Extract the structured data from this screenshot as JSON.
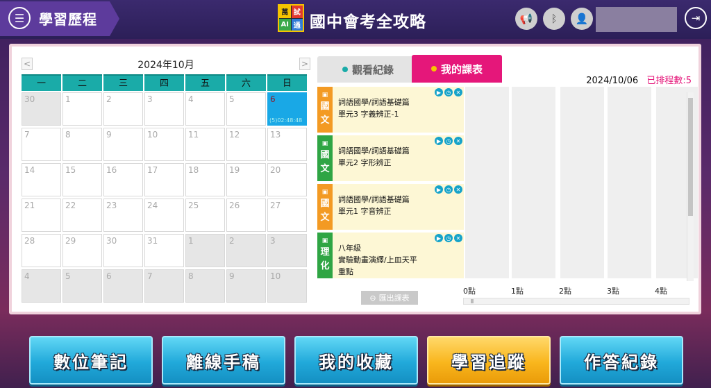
{
  "header": {
    "breadcrumb": "學習歷程",
    "logo_chars": [
      "萬",
      "試",
      "AI",
      "通"
    ],
    "app_title": "國中會考全攻略"
  },
  "calendar": {
    "month_label": "2024年10月",
    "prev": "<",
    "next": ">",
    "weekdays": [
      "一",
      "二",
      "三",
      "四",
      "五",
      "六",
      "日"
    ],
    "days": [
      {
        "d": "30",
        "m": true
      },
      {
        "d": "1"
      },
      {
        "d": "2"
      },
      {
        "d": "3"
      },
      {
        "d": "4"
      },
      {
        "d": "5"
      },
      {
        "d": "6",
        "today": true,
        "sub": "(5)02:48:48"
      },
      {
        "d": "7"
      },
      {
        "d": "8"
      },
      {
        "d": "9"
      },
      {
        "d": "10"
      },
      {
        "d": "11"
      },
      {
        "d": "12"
      },
      {
        "d": "13"
      },
      {
        "d": "14"
      },
      {
        "d": "15"
      },
      {
        "d": "16"
      },
      {
        "d": "17"
      },
      {
        "d": "18"
      },
      {
        "d": "19"
      },
      {
        "d": "20"
      },
      {
        "d": "21"
      },
      {
        "d": "22"
      },
      {
        "d": "23"
      },
      {
        "d": "24"
      },
      {
        "d": "25"
      },
      {
        "d": "26"
      },
      {
        "d": "27"
      },
      {
        "d": "28"
      },
      {
        "d": "29"
      },
      {
        "d": "30"
      },
      {
        "d": "31"
      },
      {
        "d": "1",
        "m": true
      },
      {
        "d": "2",
        "m": true
      },
      {
        "d": "3",
        "m": true
      },
      {
        "d": "4",
        "m": true
      },
      {
        "d": "5",
        "m": true
      },
      {
        "d": "6",
        "m": true
      },
      {
        "d": "7",
        "m": true
      },
      {
        "d": "8",
        "m": true
      },
      {
        "d": "9",
        "m": true
      },
      {
        "d": "10",
        "m": true
      }
    ]
  },
  "tabs": {
    "watch": "觀看紀錄",
    "schedule": "我的課表"
  },
  "schedule": {
    "date": "2024/10/06",
    "count_label": "已排程數:5",
    "lessons": [
      {
        "subject_line1": "國",
        "subject_line2": "文",
        "color": "orange",
        "line1": "詞語國學/詞語基礎篇",
        "line2": "單元3 字義辨正-1",
        "line3": ""
      },
      {
        "subject_line1": "國",
        "subject_line2": "文",
        "color": "green",
        "line1": "詞語國學/詞語基礎篇",
        "line2": "單元2 字形辨正",
        "line3": ""
      },
      {
        "subject_line1": "國",
        "subject_line2": "文",
        "color": "orange",
        "line1": "詞語國學/詞語基礎篇",
        "line2": "單元1 字音辨正",
        "line3": ""
      },
      {
        "subject_line1": "理",
        "subject_line2": "化",
        "color": "green",
        "line1": "八年級",
        "line2": "實驗動畫演繹/上皿天平",
        "line3": "重點"
      }
    ],
    "export_label": "匯出課表",
    "hours": [
      "0點",
      "1點",
      "2點",
      "3點",
      "4點"
    ]
  },
  "bottom_nav": [
    {
      "label": "數位筆記",
      "active": false
    },
    {
      "label": "離線手稿",
      "active": false
    },
    {
      "label": "我的收藏",
      "active": false
    },
    {
      "label": "學習追蹤",
      "active": true
    },
    {
      "label": "作答紀錄",
      "active": false
    }
  ]
}
